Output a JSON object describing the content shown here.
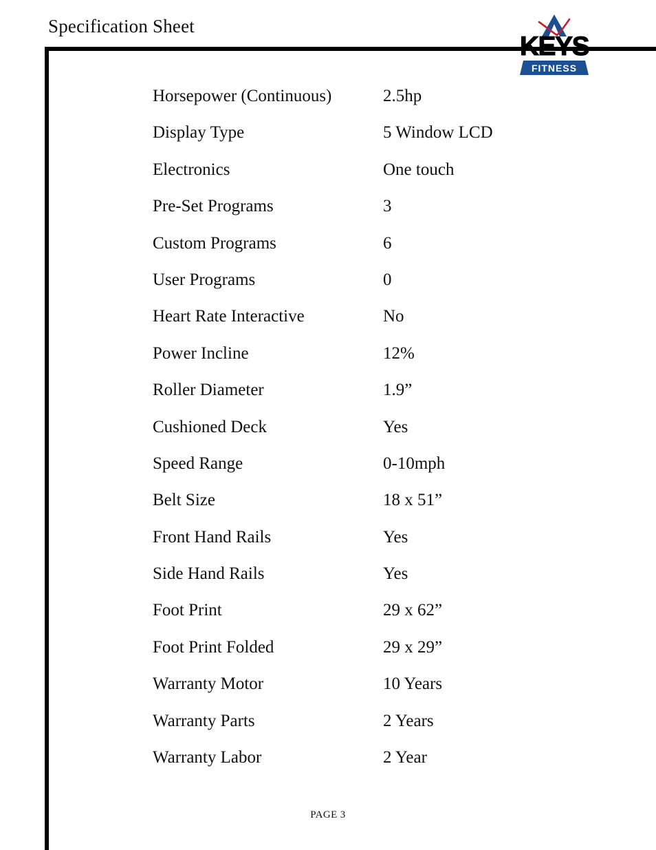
{
  "header": {
    "title": "Specification Sheet"
  },
  "logo": {
    "mark_icon": "keys-mountain-peak-icon",
    "brand": "KEYS",
    "sub_brand": "FITNESS",
    "brand_blue": "#1d4f93",
    "accent_red": "#c8202e",
    "brand_black": "#000000"
  },
  "specs": {
    "rows": [
      {
        "label": "Horsepower (Continuous)",
        "value": "2.5hp"
      },
      {
        "label": "Display Type",
        "value": "5 Window LCD"
      },
      {
        "label": "Electronics",
        "value": "One touch"
      },
      {
        "label": "Pre-Set Programs",
        "value": "3"
      },
      {
        "label": "Custom Programs",
        "value": "6"
      },
      {
        "label": "User Programs",
        "value": "0"
      },
      {
        "label": "Heart Rate Interactive",
        "value": "No"
      },
      {
        "label": "Power Incline",
        "value": "12%"
      },
      {
        "label": "Roller Diameter",
        "value": "1.9”"
      },
      {
        "label": "Cushioned Deck",
        "value": "Yes"
      },
      {
        "label": "Speed Range",
        "value": "0-10mph"
      },
      {
        "label": "Belt Size",
        "value": "18 x 51”"
      },
      {
        "label": "Front Hand Rails",
        "value": "Yes"
      },
      {
        "label": "Side Hand Rails",
        "value": "Yes"
      },
      {
        "label": "Foot Print",
        "value": "29 x 62”"
      },
      {
        "label": "Foot Print Folded",
        "value": "29 x 29”"
      },
      {
        "label": "Warranty Motor",
        "value": "10 Years"
      },
      {
        "label": "Warranty Parts",
        "value": "2 Years"
      },
      {
        "label": "Warranty Labor",
        "value": "2 Year"
      }
    ]
  },
  "footer": {
    "page_label": "PAGE 3"
  }
}
